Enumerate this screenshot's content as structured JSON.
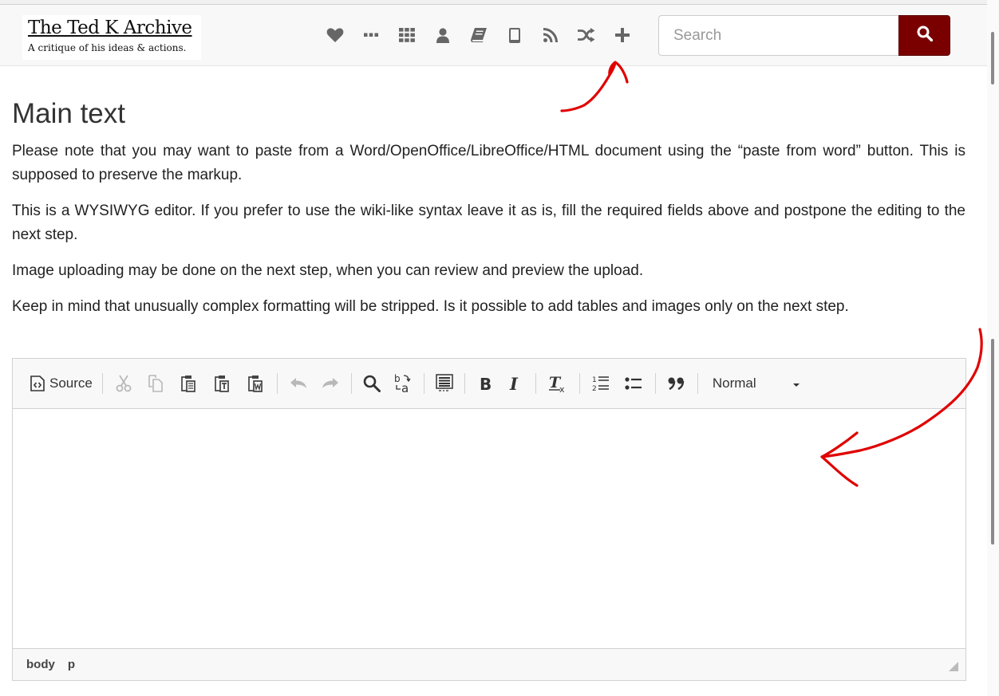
{
  "site": {
    "title": "The Ted K Archive",
    "subtitle": "A critique of his ideas & actions."
  },
  "nav_icons": [
    "heart-icon",
    "ellipsis-icon",
    "grid-icon",
    "user-icon",
    "book-icon",
    "tablet-icon",
    "rss-icon",
    "shuffle-icon",
    "plus-icon"
  ],
  "search": {
    "placeholder": "Search",
    "button_icon": "search-icon",
    "button_color": "#7a0000"
  },
  "main": {
    "heading": "Main text",
    "paragraphs": [
      "Please note that you may want to paste from a Word/OpenOffice/LibreOffice/HTML document using the “paste from word” button. This is supposed to preserve the markup.",
      "This is a WYSIWYG editor. If you prefer to use the wiki-like syntax leave it as is, fill the required fields above and postpone the editing to the next step.",
      "Image uploading may be done on the next step, when you can review and preview the upload.",
      "Keep in mind that unusually complex formatting will be stripped. Is it possible to add tables and images only on the next step."
    ]
  },
  "editor": {
    "source_label": "Source",
    "format_value": "Normal",
    "toolbar_icons": [
      "source-icon",
      "cut-icon",
      "copy-icon",
      "paste-icon",
      "paste-text-icon",
      "paste-word-icon",
      "undo-icon",
      "redo-icon",
      "find-icon",
      "replace-icon",
      "select-all-icon",
      "bold-icon",
      "italic-icon",
      "remove-format-icon",
      "numbered-list-icon",
      "bulleted-list-icon",
      "blockquote-icon"
    ],
    "path": [
      "body",
      "p"
    ]
  },
  "annotation_color": "#e00000"
}
